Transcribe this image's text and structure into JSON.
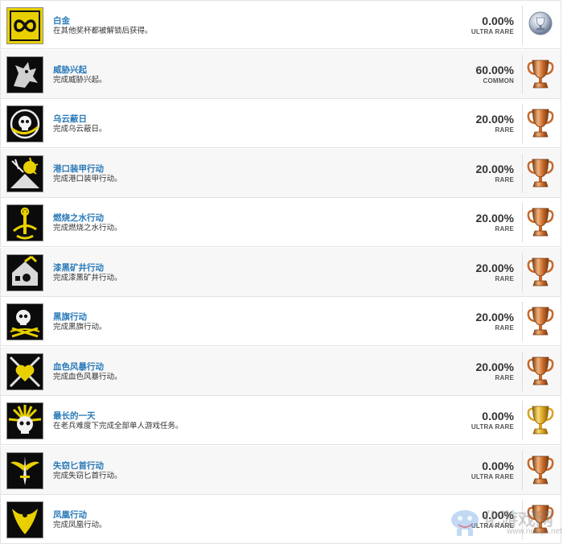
{
  "trophies": [
    {
      "title": "白金",
      "description": "在其他奖杯都被解锁后获得。",
      "percent": "0.00%",
      "rarity": "ULTRA RARE",
      "grade": "platinum",
      "icon": "infinity-emblem-icon",
      "accent": "#e8d000"
    },
    {
      "title": "威胁兴起",
      "description": "完成威胁兴起。",
      "percent": "60.00%",
      "rarity": "COMMON",
      "grade": "bronze",
      "icon": "gargoyle-icon",
      "accent": "#bfbfbf"
    },
    {
      "title": "乌云蔽日",
      "description": "完成乌云蔽日。",
      "percent": "20.00%",
      "rarity": "RARE",
      "grade": "bronze",
      "icon": "skull-swirl-icon",
      "accent": "#e8d000"
    },
    {
      "title": "港口装甲行动",
      "description": "完成港口装甲行动。",
      "percent": "20.00%",
      "rarity": "RARE",
      "grade": "bronze",
      "icon": "harbor-blast-icon",
      "accent": "#e8d000"
    },
    {
      "title": "燃烧之水行动",
      "description": "完成燃烧之水行动。",
      "percent": "20.00%",
      "rarity": "RARE",
      "grade": "bronze",
      "icon": "anchor-icon",
      "accent": "#e8d000"
    },
    {
      "title": "漆黑矿井行动",
      "description": "完成漆黑矿井行动。",
      "percent": "20.00%",
      "rarity": "RARE",
      "grade": "bronze",
      "icon": "mine-house-icon",
      "accent": "#e8d000"
    },
    {
      "title": "黑旗行动",
      "description": "完成黑旗行动。",
      "percent": "20.00%",
      "rarity": "RARE",
      "grade": "bronze",
      "icon": "jolly-roger-icon",
      "accent": "#e8d000"
    },
    {
      "title": "血色风暴行动",
      "description": "完成血色风暴行动。",
      "percent": "20.00%",
      "rarity": "RARE",
      "grade": "bronze",
      "icon": "crossed-swords-heart-icon",
      "accent": "#e8d000"
    },
    {
      "title": "最长的一天",
      "description": "在老兵难度下完成全部单人游戏任务。",
      "percent": "0.00%",
      "rarity": "ULTRA RARE",
      "grade": "gold",
      "icon": "sunburst-skull-icon",
      "accent": "#e8d000"
    },
    {
      "title": "失窃匕首行动",
      "description": "完成失窃匕首行动。",
      "percent": "0.00%",
      "rarity": "ULTRA RARE",
      "grade": "bronze",
      "icon": "winged-dagger-icon",
      "accent": "#e8d000"
    },
    {
      "title": "凤凰行动",
      "description": "完成凤凰行动。",
      "percent": "0.00%",
      "rarity": "ULTRA RARE",
      "grade": "bronze",
      "icon": "phoenix-icon",
      "accent": "#e8d000"
    }
  ],
  "watermark": {
    "text": "化游戏网",
    "url": "www.newyx.net"
  },
  "colors": {
    "title": "#2a7ab8",
    "bronze": "#c8692a",
    "gold": "#d9a21f",
    "platinum": "#9aa7bb"
  }
}
